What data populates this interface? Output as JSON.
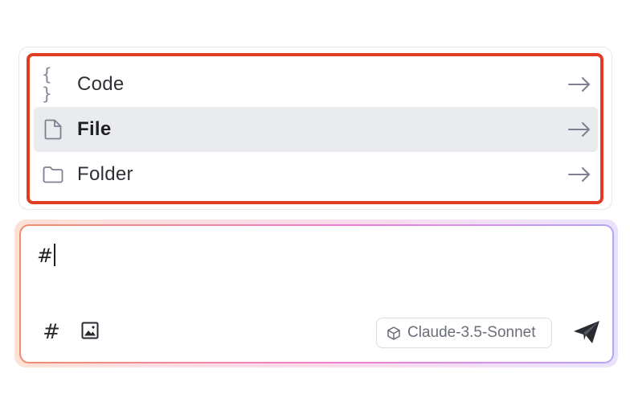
{
  "menu": {
    "items": [
      {
        "label": "Code",
        "icon": "braces-icon",
        "selected": false
      },
      {
        "label": "File",
        "icon": "file-icon",
        "selected": true
      },
      {
        "label": "Folder",
        "icon": "folder-icon",
        "selected": false
      }
    ],
    "braces_glyph": "{ }"
  },
  "composer": {
    "input_value": "#",
    "hash_button": "#",
    "model": "Claude-3.5-Sonnet"
  },
  "colors": {
    "highlight": "#e23b24",
    "selected_row": "#eaebee",
    "gradient_start": "#f08c6c",
    "gradient_mid": "#ec7fd2",
    "gradient_end": "#b7a4f6"
  }
}
